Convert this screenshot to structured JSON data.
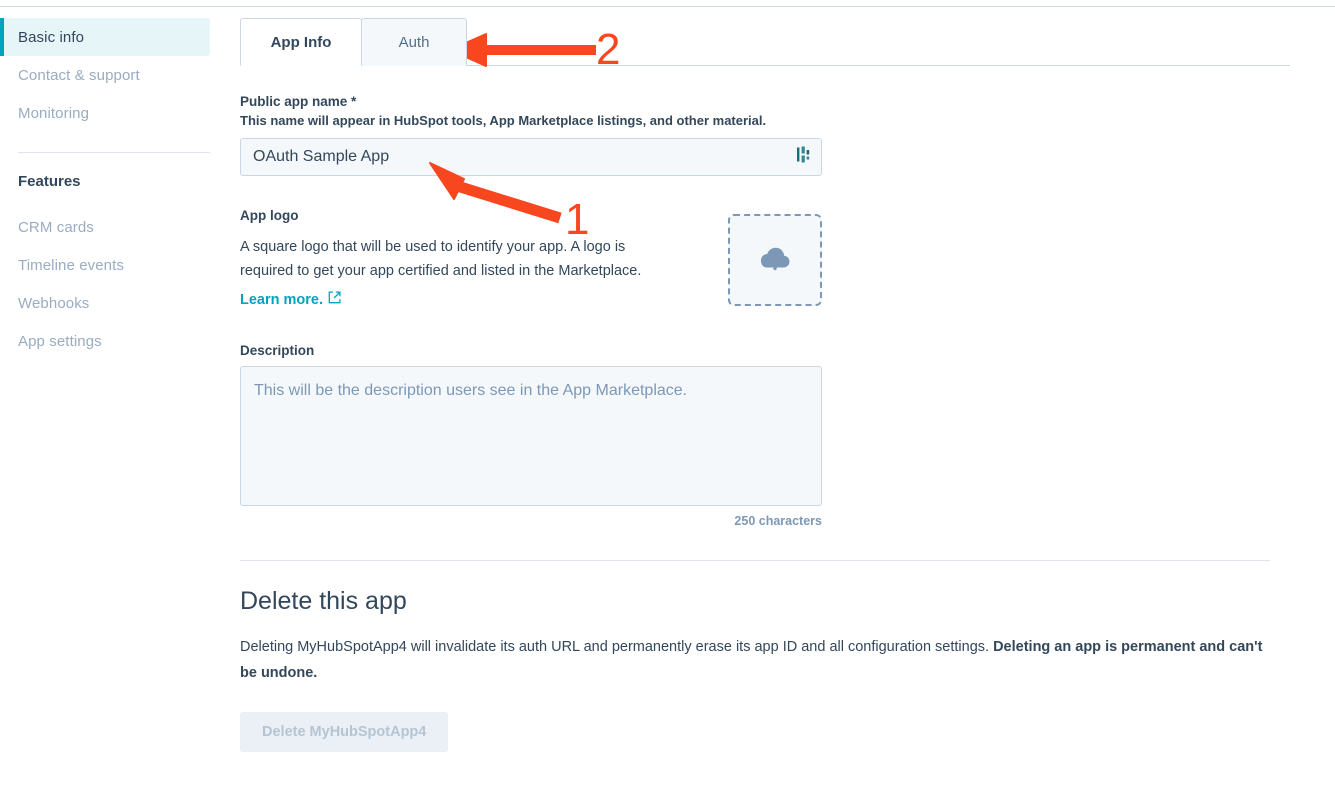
{
  "sidebar": {
    "items": [
      {
        "label": "Basic info",
        "active": true
      },
      {
        "label": "Contact & support",
        "active": false
      },
      {
        "label": "Monitoring",
        "active": false
      }
    ],
    "features_heading": "Features",
    "feature_items": [
      {
        "label": "CRM cards"
      },
      {
        "label": "Timeline events"
      },
      {
        "label": "Webhooks"
      },
      {
        "label": "App settings"
      }
    ]
  },
  "tabs": [
    {
      "label": "App Info",
      "active": true
    },
    {
      "label": "Auth",
      "active": false
    }
  ],
  "form": {
    "app_name": {
      "label": "Public app name *",
      "help": "This name will appear in HubSpot tools, App Marketplace listings, and other material.",
      "value": "OAuth Sample App",
      "adornment_icon": "hubspot-sprocket-icon"
    },
    "app_logo": {
      "label": "App logo",
      "description": "A square logo that will be used to identify your app. A logo is required to get your app certified and listed in the Marketplace.",
      "link_label": "Learn more.",
      "link_icon": "external-link-icon",
      "dropzone_icon": "cloud-upload-icon"
    },
    "description": {
      "label": "Description",
      "value": "",
      "placeholder": "This will be the description users see in the App Marketplace.",
      "char_count": "250 characters"
    }
  },
  "delete_section": {
    "title": "Delete this app",
    "body_lead": "Deleting MyHubSpotApp4 will invalidate its auth URL and permanently erase its app ID and all configuration settings. ",
    "body_bold": "Deleting an app is permanent and can't be undone.",
    "button_label": "Delete MyHubSpotApp4"
  },
  "annotations": [
    {
      "number": "1",
      "target": "app-name-input"
    },
    {
      "number": "2",
      "target": "auth-tab"
    }
  ],
  "colors": {
    "accent_teal": "#00A4BD",
    "text_dark": "#33475B",
    "text_muted": "#99ACC2",
    "field_bg": "#F5F8FA",
    "border": "#CBD6E2",
    "annotation_red": "#F8461E"
  }
}
